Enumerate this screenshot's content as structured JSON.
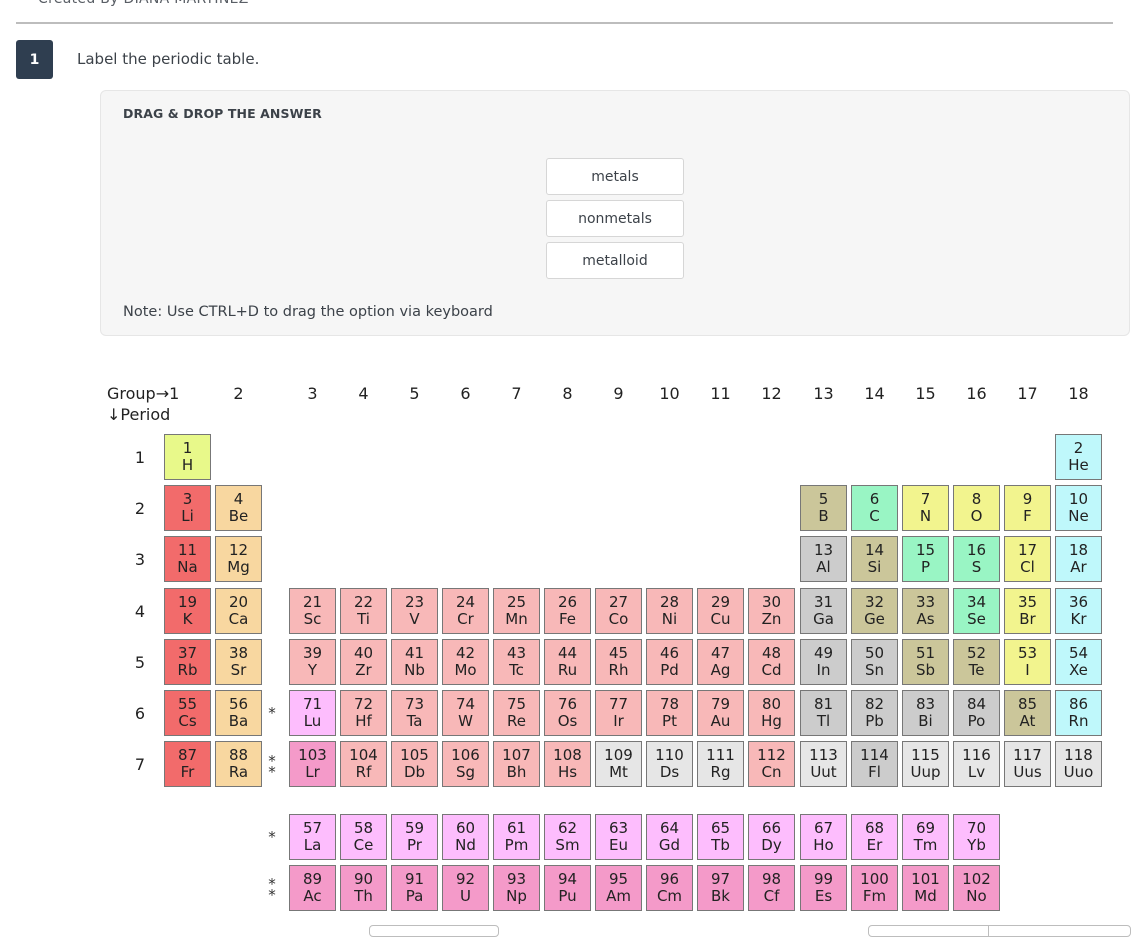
{
  "header": {
    "creator": "Created By DIANA MARTINEZ"
  },
  "question": {
    "number": "1",
    "prompt": "Label the periodic table."
  },
  "drag_panel": {
    "title": "DRAG & DROP THE ANSWER",
    "options": [
      "metals",
      "nonmetals",
      "metalloid"
    ],
    "note": "Note: Use CTRL+D to drag the option via keyboard"
  },
  "periodic_table": {
    "group_label": "Group→1",
    "period_label": "↓Period",
    "groups": [
      "2",
      "3",
      "4",
      "5",
      "6",
      "7",
      "8",
      "9",
      "10",
      "11",
      "12",
      "13",
      "14",
      "15",
      "16",
      "17",
      "18"
    ],
    "periods": [
      "1",
      "2",
      "3",
      "4",
      "5",
      "6",
      "7"
    ],
    "category_colors": {
      "hydrogen": "#e8f98a",
      "alkali": "#f26b6b",
      "alkaline": "#f8d7a0",
      "transition": "#f8b8b8",
      "lanthanide": "#fdbdfd",
      "actinide": "#f49ac9",
      "post_transition": "#cccccc",
      "metalloid": "#cbc69a",
      "nonmetal": "#99f5c4",
      "halogen": "#f2f48e",
      "noble": "#bff8fb",
      "unknown": "#e6e6e6"
    },
    "asterisks": {
      "lanthanide_marker": "*",
      "actinide_marker": "*\n*"
    },
    "elements": [
      {
        "n": "1",
        "s": "H",
        "g": 1,
        "p": 1,
        "c": "hydrogen"
      },
      {
        "n": "2",
        "s": "He",
        "g": 18,
        "p": 1,
        "c": "noble"
      },
      {
        "n": "3",
        "s": "Li",
        "g": 1,
        "p": 2,
        "c": "alkali"
      },
      {
        "n": "4",
        "s": "Be",
        "g": 2,
        "p": 2,
        "c": "alkaline"
      },
      {
        "n": "5",
        "s": "B",
        "g": 13,
        "p": 2,
        "c": "metalloid"
      },
      {
        "n": "6",
        "s": "C",
        "g": 14,
        "p": 2,
        "c": "nonmetal"
      },
      {
        "n": "7",
        "s": "N",
        "g": 15,
        "p": 2,
        "c": "halogen"
      },
      {
        "n": "8",
        "s": "O",
        "g": 16,
        "p": 2,
        "c": "halogen"
      },
      {
        "n": "9",
        "s": "F",
        "g": 17,
        "p": 2,
        "c": "halogen"
      },
      {
        "n": "10",
        "s": "Ne",
        "g": 18,
        "p": 2,
        "c": "noble"
      },
      {
        "n": "11",
        "s": "Na",
        "g": 1,
        "p": 3,
        "c": "alkali"
      },
      {
        "n": "12",
        "s": "Mg",
        "g": 2,
        "p": 3,
        "c": "alkaline"
      },
      {
        "n": "13",
        "s": "Al",
        "g": 13,
        "p": 3,
        "c": "post_transition"
      },
      {
        "n": "14",
        "s": "Si",
        "g": 14,
        "p": 3,
        "c": "metalloid"
      },
      {
        "n": "15",
        "s": "P",
        "g": 15,
        "p": 3,
        "c": "nonmetal"
      },
      {
        "n": "16",
        "s": "S",
        "g": 16,
        "p": 3,
        "c": "nonmetal"
      },
      {
        "n": "17",
        "s": "Cl",
        "g": 17,
        "p": 3,
        "c": "halogen"
      },
      {
        "n": "18",
        "s": "Ar",
        "g": 18,
        "p": 3,
        "c": "noble"
      },
      {
        "n": "19",
        "s": "K",
        "g": 1,
        "p": 4,
        "c": "alkali"
      },
      {
        "n": "20",
        "s": "Ca",
        "g": 2,
        "p": 4,
        "c": "alkaline"
      },
      {
        "n": "21",
        "s": "Sc",
        "g": 3,
        "p": 4,
        "c": "transition"
      },
      {
        "n": "22",
        "s": "Ti",
        "g": 4,
        "p": 4,
        "c": "transition"
      },
      {
        "n": "23",
        "s": "V",
        "g": 5,
        "p": 4,
        "c": "transition"
      },
      {
        "n": "24",
        "s": "Cr",
        "g": 6,
        "p": 4,
        "c": "transition"
      },
      {
        "n": "25",
        "s": "Mn",
        "g": 7,
        "p": 4,
        "c": "transition"
      },
      {
        "n": "26",
        "s": "Fe",
        "g": 8,
        "p": 4,
        "c": "transition"
      },
      {
        "n": "27",
        "s": "Co",
        "g": 9,
        "p": 4,
        "c": "transition"
      },
      {
        "n": "28",
        "s": "Ni",
        "g": 10,
        "p": 4,
        "c": "transition"
      },
      {
        "n": "29",
        "s": "Cu",
        "g": 11,
        "p": 4,
        "c": "transition"
      },
      {
        "n": "30",
        "s": "Zn",
        "g": 12,
        "p": 4,
        "c": "transition"
      },
      {
        "n": "31",
        "s": "Ga",
        "g": 13,
        "p": 4,
        "c": "post_transition"
      },
      {
        "n": "32",
        "s": "Ge",
        "g": 14,
        "p": 4,
        "c": "metalloid"
      },
      {
        "n": "33",
        "s": "As",
        "g": 15,
        "p": 4,
        "c": "metalloid"
      },
      {
        "n": "34",
        "s": "Se",
        "g": 16,
        "p": 4,
        "c": "nonmetal"
      },
      {
        "n": "35",
        "s": "Br",
        "g": 17,
        "p": 4,
        "c": "halogen"
      },
      {
        "n": "36",
        "s": "Kr",
        "g": 18,
        "p": 4,
        "c": "noble"
      },
      {
        "n": "37",
        "s": "Rb",
        "g": 1,
        "p": 5,
        "c": "alkali"
      },
      {
        "n": "38",
        "s": "Sr",
        "g": 2,
        "p": 5,
        "c": "alkaline"
      },
      {
        "n": "39",
        "s": "Y",
        "g": 3,
        "p": 5,
        "c": "transition"
      },
      {
        "n": "40",
        "s": "Zr",
        "g": 4,
        "p": 5,
        "c": "transition"
      },
      {
        "n": "41",
        "s": "Nb",
        "g": 5,
        "p": 5,
        "c": "transition"
      },
      {
        "n": "42",
        "s": "Mo",
        "g": 6,
        "p": 5,
        "c": "transition"
      },
      {
        "n": "43",
        "s": "Tc",
        "g": 7,
        "p": 5,
        "c": "transition"
      },
      {
        "n": "44",
        "s": "Ru",
        "g": 8,
        "p": 5,
        "c": "transition"
      },
      {
        "n": "45",
        "s": "Rh",
        "g": 9,
        "p": 5,
        "c": "transition"
      },
      {
        "n": "46",
        "s": "Pd",
        "g": 10,
        "p": 5,
        "c": "transition"
      },
      {
        "n": "47",
        "s": "Ag",
        "g": 11,
        "p": 5,
        "c": "transition"
      },
      {
        "n": "48",
        "s": "Cd",
        "g": 12,
        "p": 5,
        "c": "transition"
      },
      {
        "n": "49",
        "s": "In",
        "g": 13,
        "p": 5,
        "c": "post_transition"
      },
      {
        "n": "50",
        "s": "Sn",
        "g": 14,
        "p": 5,
        "c": "post_transition"
      },
      {
        "n": "51",
        "s": "Sb",
        "g": 15,
        "p": 5,
        "c": "metalloid"
      },
      {
        "n": "52",
        "s": "Te",
        "g": 16,
        "p": 5,
        "c": "metalloid"
      },
      {
        "n": "53",
        "s": "I",
        "g": 17,
        "p": 5,
        "c": "halogen"
      },
      {
        "n": "54",
        "s": "Xe",
        "g": 18,
        "p": 5,
        "c": "noble"
      },
      {
        "n": "55",
        "s": "Cs",
        "g": 1,
        "p": 6,
        "c": "alkali"
      },
      {
        "n": "56",
        "s": "Ba",
        "g": 2,
        "p": 6,
        "c": "alkaline"
      },
      {
        "n": "71",
        "s": "Lu",
        "g": 3,
        "p": 6,
        "c": "lanthanide"
      },
      {
        "n": "72",
        "s": "Hf",
        "g": 4,
        "p": 6,
        "c": "transition"
      },
      {
        "n": "73",
        "s": "Ta",
        "g": 5,
        "p": 6,
        "c": "transition"
      },
      {
        "n": "74",
        "s": "W",
        "g": 6,
        "p": 6,
        "c": "transition"
      },
      {
        "n": "75",
        "s": "Re",
        "g": 7,
        "p": 6,
        "c": "transition"
      },
      {
        "n": "76",
        "s": "Os",
        "g": 8,
        "p": 6,
        "c": "transition"
      },
      {
        "n": "77",
        "s": "Ir",
        "g": 9,
        "p": 6,
        "c": "transition"
      },
      {
        "n": "78",
        "s": "Pt",
        "g": 10,
        "p": 6,
        "c": "transition"
      },
      {
        "n": "79",
        "s": "Au",
        "g": 11,
        "p": 6,
        "c": "transition"
      },
      {
        "n": "80",
        "s": "Hg",
        "g": 12,
        "p": 6,
        "c": "transition"
      },
      {
        "n": "81",
        "s": "Tl",
        "g": 13,
        "p": 6,
        "c": "post_transition"
      },
      {
        "n": "82",
        "s": "Pb",
        "g": 14,
        "p": 6,
        "c": "post_transition"
      },
      {
        "n": "83",
        "s": "Bi",
        "g": 15,
        "p": 6,
        "c": "post_transition"
      },
      {
        "n": "84",
        "s": "Po",
        "g": 16,
        "p": 6,
        "c": "post_transition"
      },
      {
        "n": "85",
        "s": "At",
        "g": 17,
        "p": 6,
        "c": "metalloid"
      },
      {
        "n": "86",
        "s": "Rn",
        "g": 18,
        "p": 6,
        "c": "noble"
      },
      {
        "n": "87",
        "s": "Fr",
        "g": 1,
        "p": 7,
        "c": "alkali"
      },
      {
        "n": "88",
        "s": "Ra",
        "g": 2,
        "p": 7,
        "c": "alkaline"
      },
      {
        "n": "103",
        "s": "Lr",
        "g": 3,
        "p": 7,
        "c": "actinide"
      },
      {
        "n": "104",
        "s": "Rf",
        "g": 4,
        "p": 7,
        "c": "transition"
      },
      {
        "n": "105",
        "s": "Db",
        "g": 5,
        "p": 7,
        "c": "transition"
      },
      {
        "n": "106",
        "s": "Sg",
        "g": 6,
        "p": 7,
        "c": "transition"
      },
      {
        "n": "107",
        "s": "Bh",
        "g": 7,
        "p": 7,
        "c": "transition"
      },
      {
        "n": "108",
        "s": "Hs",
        "g": 8,
        "p": 7,
        "c": "transition"
      },
      {
        "n": "109",
        "s": "Mt",
        "g": 9,
        "p": 7,
        "c": "unknown"
      },
      {
        "n": "110",
        "s": "Ds",
        "g": 10,
        "p": 7,
        "c": "unknown"
      },
      {
        "n": "111",
        "s": "Rg",
        "g": 11,
        "p": 7,
        "c": "unknown"
      },
      {
        "n": "112",
        "s": "Cn",
        "g": 12,
        "p": 7,
        "c": "transition"
      },
      {
        "n": "113",
        "s": "Uut",
        "g": 13,
        "p": 7,
        "c": "unknown"
      },
      {
        "n": "114",
        "s": "Fl",
        "g": 14,
        "p": 7,
        "c": "post_transition"
      },
      {
        "n": "115",
        "s": "Uup",
        "g": 15,
        "p": 7,
        "c": "unknown"
      },
      {
        "n": "116",
        "s": "Lv",
        "g": 16,
        "p": 7,
        "c": "unknown"
      },
      {
        "n": "117",
        "s": "Uus",
        "g": 17,
        "p": 7,
        "c": "unknown"
      },
      {
        "n": "118",
        "s": "Uuo",
        "g": 18,
        "p": 7,
        "c": "unknown"
      },
      {
        "n": "57",
        "s": "La",
        "g": 3,
        "p": 8,
        "c": "lanthanide"
      },
      {
        "n": "58",
        "s": "Ce",
        "g": 4,
        "p": 8,
        "c": "lanthanide"
      },
      {
        "n": "59",
        "s": "Pr",
        "g": 5,
        "p": 8,
        "c": "lanthanide"
      },
      {
        "n": "60",
        "s": "Nd",
        "g": 6,
        "p": 8,
        "c": "lanthanide"
      },
      {
        "n": "61",
        "s": "Pm",
        "g": 7,
        "p": 8,
        "c": "lanthanide"
      },
      {
        "n": "62",
        "s": "Sm",
        "g": 8,
        "p": 8,
        "c": "lanthanide"
      },
      {
        "n": "63",
        "s": "Eu",
        "g": 9,
        "p": 8,
        "c": "lanthanide"
      },
      {
        "n": "64",
        "s": "Gd",
        "g": 10,
        "p": 8,
        "c": "lanthanide"
      },
      {
        "n": "65",
        "s": "Tb",
        "g": 11,
        "p": 8,
        "c": "lanthanide"
      },
      {
        "n": "66",
        "s": "Dy",
        "g": 12,
        "p": 8,
        "c": "lanthanide"
      },
      {
        "n": "67",
        "s": "Ho",
        "g": 13,
        "p": 8,
        "c": "lanthanide"
      },
      {
        "n": "68",
        "s": "Er",
        "g": 14,
        "p": 8,
        "c": "lanthanide"
      },
      {
        "n": "69",
        "s": "Tm",
        "g": 15,
        "p": 8,
        "c": "lanthanide"
      },
      {
        "n": "70",
        "s": "Yb",
        "g": 16,
        "p": 8,
        "c": "lanthanide"
      },
      {
        "n": "89",
        "s": "Ac",
        "g": 3,
        "p": 9,
        "c": "actinide"
      },
      {
        "n": "90",
        "s": "Th",
        "g": 4,
        "p": 9,
        "c": "actinide"
      },
      {
        "n": "91",
        "s": "Pa",
        "g": 5,
        "p": 9,
        "c": "actinide"
      },
      {
        "n": "92",
        "s": "U",
        "g": 6,
        "p": 9,
        "c": "actinide"
      },
      {
        "n": "93",
        "s": "Np",
        "g": 7,
        "p": 9,
        "c": "actinide"
      },
      {
        "n": "94",
        "s": "Pu",
        "g": 8,
        "p": 9,
        "c": "actinide"
      },
      {
        "n": "95",
        "s": "Am",
        "g": 9,
        "p": 9,
        "c": "actinide"
      },
      {
        "n": "96",
        "s": "Cm",
        "g": 10,
        "p": 9,
        "c": "actinide"
      },
      {
        "n": "97",
        "s": "Bk",
        "g": 11,
        "p": 9,
        "c": "actinide"
      },
      {
        "n": "98",
        "s": "Cf",
        "g": 12,
        "p": 9,
        "c": "actinide"
      },
      {
        "n": "99",
        "s": "Es",
        "g": 13,
        "p": 9,
        "c": "actinide"
      },
      {
        "n": "100",
        "s": "Fm",
        "g": 14,
        "p": 9,
        "c": "actinide"
      },
      {
        "n": "101",
        "s": "Md",
        "g": 15,
        "p": 9,
        "c": "actinide"
      },
      {
        "n": "102",
        "s": "No",
        "g": 16,
        "p": 9,
        "c": "actinide"
      }
    ]
  }
}
